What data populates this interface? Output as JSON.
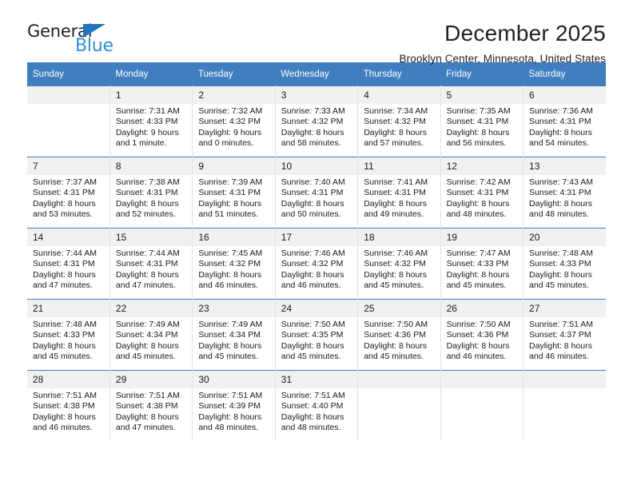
{
  "brand": {
    "name_part1": "General",
    "name_part2": "Blue",
    "triangle_color": "#1f76bc",
    "blue_color": "#2e92d6"
  },
  "header": {
    "month_title": "December 2025",
    "location": "Brooklyn Center, Minnesota, United States"
  },
  "calendar": {
    "header_color": "#3f7fbf",
    "weekdays": [
      "Sunday",
      "Monday",
      "Tuesday",
      "Wednesday",
      "Thursday",
      "Friday",
      "Saturday"
    ],
    "weeks": [
      [
        {
          "day": "",
          "sunrise": "",
          "sunset": "",
          "daylight": "",
          "empty": true
        },
        {
          "day": "1",
          "sunrise": "Sunrise: 7:31 AM",
          "sunset": "Sunset: 4:33 PM",
          "daylight": "Daylight: 9 hours and 1 minute."
        },
        {
          "day": "2",
          "sunrise": "Sunrise: 7:32 AM",
          "sunset": "Sunset: 4:32 PM",
          "daylight": "Daylight: 9 hours and 0 minutes."
        },
        {
          "day": "3",
          "sunrise": "Sunrise: 7:33 AM",
          "sunset": "Sunset: 4:32 PM",
          "daylight": "Daylight: 8 hours and 58 minutes."
        },
        {
          "day": "4",
          "sunrise": "Sunrise: 7:34 AM",
          "sunset": "Sunset: 4:32 PM",
          "daylight": "Daylight: 8 hours and 57 minutes."
        },
        {
          "day": "5",
          "sunrise": "Sunrise: 7:35 AM",
          "sunset": "Sunset: 4:31 PM",
          "daylight": "Daylight: 8 hours and 56 minutes."
        },
        {
          "day": "6",
          "sunrise": "Sunrise: 7:36 AM",
          "sunset": "Sunset: 4:31 PM",
          "daylight": "Daylight: 8 hours and 54 minutes."
        }
      ],
      [
        {
          "day": "7",
          "sunrise": "Sunrise: 7:37 AM",
          "sunset": "Sunset: 4:31 PM",
          "daylight": "Daylight: 8 hours and 53 minutes."
        },
        {
          "day": "8",
          "sunrise": "Sunrise: 7:38 AM",
          "sunset": "Sunset: 4:31 PM",
          "daylight": "Daylight: 8 hours and 52 minutes."
        },
        {
          "day": "9",
          "sunrise": "Sunrise: 7:39 AM",
          "sunset": "Sunset: 4:31 PM",
          "daylight": "Daylight: 8 hours and 51 minutes."
        },
        {
          "day": "10",
          "sunrise": "Sunrise: 7:40 AM",
          "sunset": "Sunset: 4:31 PM",
          "daylight": "Daylight: 8 hours and 50 minutes."
        },
        {
          "day": "11",
          "sunrise": "Sunrise: 7:41 AM",
          "sunset": "Sunset: 4:31 PM",
          "daylight": "Daylight: 8 hours and 49 minutes."
        },
        {
          "day": "12",
          "sunrise": "Sunrise: 7:42 AM",
          "sunset": "Sunset: 4:31 PM",
          "daylight": "Daylight: 8 hours and 48 minutes."
        },
        {
          "day": "13",
          "sunrise": "Sunrise: 7:43 AM",
          "sunset": "Sunset: 4:31 PM",
          "daylight": "Daylight: 8 hours and 48 minutes."
        }
      ],
      [
        {
          "day": "14",
          "sunrise": "Sunrise: 7:44 AM",
          "sunset": "Sunset: 4:31 PM",
          "daylight": "Daylight: 8 hours and 47 minutes."
        },
        {
          "day": "15",
          "sunrise": "Sunrise: 7:44 AM",
          "sunset": "Sunset: 4:31 PM",
          "daylight": "Daylight: 8 hours and 47 minutes."
        },
        {
          "day": "16",
          "sunrise": "Sunrise: 7:45 AM",
          "sunset": "Sunset: 4:32 PM",
          "daylight": "Daylight: 8 hours and 46 minutes."
        },
        {
          "day": "17",
          "sunrise": "Sunrise: 7:46 AM",
          "sunset": "Sunset: 4:32 PM",
          "daylight": "Daylight: 8 hours and 46 minutes."
        },
        {
          "day": "18",
          "sunrise": "Sunrise: 7:46 AM",
          "sunset": "Sunset: 4:32 PM",
          "daylight": "Daylight: 8 hours and 45 minutes."
        },
        {
          "day": "19",
          "sunrise": "Sunrise: 7:47 AM",
          "sunset": "Sunset: 4:33 PM",
          "daylight": "Daylight: 8 hours and 45 minutes."
        },
        {
          "day": "20",
          "sunrise": "Sunrise: 7:48 AM",
          "sunset": "Sunset: 4:33 PM",
          "daylight": "Daylight: 8 hours and 45 minutes."
        }
      ],
      [
        {
          "day": "21",
          "sunrise": "Sunrise: 7:48 AM",
          "sunset": "Sunset: 4:33 PM",
          "daylight": "Daylight: 8 hours and 45 minutes."
        },
        {
          "day": "22",
          "sunrise": "Sunrise: 7:49 AM",
          "sunset": "Sunset: 4:34 PM",
          "daylight": "Daylight: 8 hours and 45 minutes."
        },
        {
          "day": "23",
          "sunrise": "Sunrise: 7:49 AM",
          "sunset": "Sunset: 4:34 PM",
          "daylight": "Daylight: 8 hours and 45 minutes."
        },
        {
          "day": "24",
          "sunrise": "Sunrise: 7:50 AM",
          "sunset": "Sunset: 4:35 PM",
          "daylight": "Daylight: 8 hours and 45 minutes."
        },
        {
          "day": "25",
          "sunrise": "Sunrise: 7:50 AM",
          "sunset": "Sunset: 4:36 PM",
          "daylight": "Daylight: 8 hours and 45 minutes."
        },
        {
          "day": "26",
          "sunrise": "Sunrise: 7:50 AM",
          "sunset": "Sunset: 4:36 PM",
          "daylight": "Daylight: 8 hours and 46 minutes."
        },
        {
          "day": "27",
          "sunrise": "Sunrise: 7:51 AM",
          "sunset": "Sunset: 4:37 PM",
          "daylight": "Daylight: 8 hours and 46 minutes."
        }
      ],
      [
        {
          "day": "28",
          "sunrise": "Sunrise: 7:51 AM",
          "sunset": "Sunset: 4:38 PM",
          "daylight": "Daylight: 8 hours and 46 minutes."
        },
        {
          "day": "29",
          "sunrise": "Sunrise: 7:51 AM",
          "sunset": "Sunset: 4:38 PM",
          "daylight": "Daylight: 8 hours and 47 minutes."
        },
        {
          "day": "30",
          "sunrise": "Sunrise: 7:51 AM",
          "sunset": "Sunset: 4:39 PM",
          "daylight": "Daylight: 8 hours and 48 minutes."
        },
        {
          "day": "31",
          "sunrise": "Sunrise: 7:51 AM",
          "sunset": "Sunset: 4:40 PM",
          "daylight": "Daylight: 8 hours and 48 minutes."
        },
        {
          "day": "",
          "sunrise": "",
          "sunset": "",
          "daylight": "",
          "empty": true
        },
        {
          "day": "",
          "sunrise": "",
          "sunset": "",
          "daylight": "",
          "empty": true
        },
        {
          "day": "",
          "sunrise": "",
          "sunset": "",
          "daylight": "",
          "empty": true
        }
      ]
    ]
  }
}
